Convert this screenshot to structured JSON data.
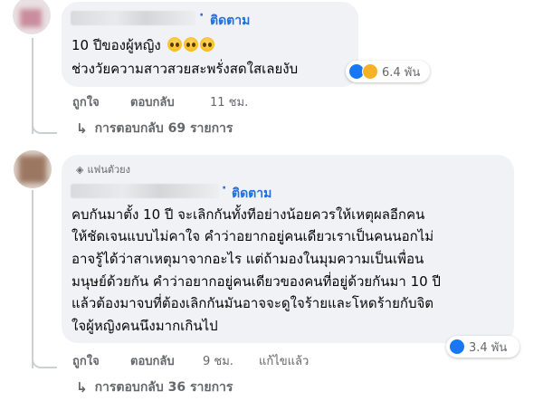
{
  "comment1": {
    "follow_label": "ติดตาม",
    "line1": "10 ปีของผู้หญิง",
    "line1_emoji": [
      "pleading-face",
      "pleading-face",
      "pleading-face"
    ],
    "line2": "ช่วงวัยความสาวสวยสะพรั่งสดใสเลยงับ",
    "reaction_count": "6.4 พัน",
    "reactions": [
      "like-icon",
      "sad-face-icon"
    ],
    "like_label": "ถูกใจ",
    "reply_label": "ตอบกลับ",
    "time": "11 ชม.",
    "replies_link": "การตอบกลับ 69 รายการ"
  },
  "comment2": {
    "badge": "แฟนตัวยง",
    "follow_label": "ติดตาม",
    "lines": [
      "คบกันมาตั้ง 10 ปี จะเลิกกันทั้งทีอย่างน้อยควรให้เหตุผลอีกคน",
      "ให้ชัดเจนแบบไม่คาใจ คำว่าอยากอยู่คนเดียวเราเป็นคนนอกไม่",
      "อาจรู้ได้ว่าสาเหตุมาจากอะไร แต่ถ้ามองในมุมความเป็นเพื่อน",
      "มนุษย์ด้วยกัน คำว่าอยากอยู่คนเดียวของคนที่อยู่ด้วยกันมา 10 ปี",
      "แล้วต้องมาจบที่ต้องเลิกกันมันอาจจะดูใจร้ายและโหดร้ายกับจิต",
      "ใจผู้หญิงคนนึงมากเกินไป"
    ],
    "reaction_count": "3.4 พัน",
    "reactions": [
      "like-icon"
    ],
    "like_label": "ถูกใจ",
    "reply_label": "ตอบกลับ",
    "time": "9 ชม.",
    "edited": "แก้ไขแล้ว",
    "replies_link": "การตอบกลับ 36 รายการ"
  },
  "colors": {
    "bubble": "#f0f2f5",
    "follow": "#216fdb",
    "meta": "#65676b",
    "like": "#1877f2"
  }
}
